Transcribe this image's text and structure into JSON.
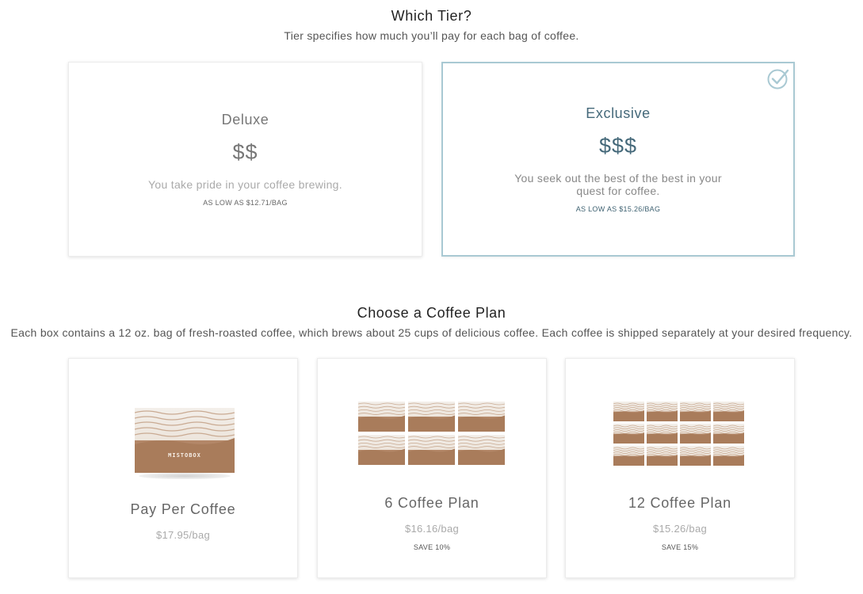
{
  "tier_section": {
    "title": "Which Tier?",
    "subtitle": "Tier specifies how much you’ll pay for each bag of coffee."
  },
  "tiers": [
    {
      "name": "Deluxe",
      "price_symbol": "$$",
      "description": "You take pride in your coffee brewing.",
      "as_low_as": "AS LOW AS $12.71/BAG",
      "selected": false
    },
    {
      "name": "Exclusive",
      "price_symbol": "$$$",
      "description": "You seek out the best of the best in your quest for coffee.",
      "as_low_as": "AS LOW AS $15.26/BAG",
      "selected": true,
      "selected_icon": "check-circle-icon"
    }
  ],
  "plan_section": {
    "title": "Choose a Coffee Plan",
    "subtitle": "Each box contains a 12 oz. bag of fresh-roasted coffee, which brews about 25 cups of delicious coffee. Each coffee is shipped separately at your desired frequency."
  },
  "plans": [
    {
      "name": "Pay Per Coffee",
      "price": "$17.95/bag",
      "save": "",
      "box_count": 1
    },
    {
      "name": "6 Coffee Plan",
      "price": "$16.16/bag",
      "save": "SAVE 10%",
      "box_count": 6
    },
    {
      "name": "12 Coffee Plan",
      "price": "$15.26/bag",
      "save": "SAVE 15%",
      "box_count": 12
    }
  ],
  "box_brand": "MISTOBOX",
  "colors": {
    "selected_border": "#a9c9d3",
    "selected_text": "#45697a",
    "box_kraft": "#a57857"
  }
}
